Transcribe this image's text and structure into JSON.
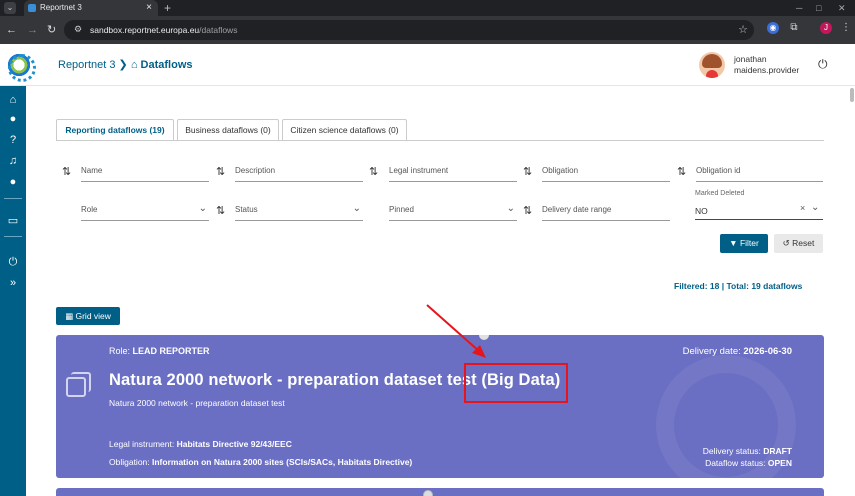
{
  "browser": {
    "tab_title": "Reportnet 3",
    "new_tab": "+",
    "url_host": "sandbox.reportnet.europa.eu",
    "url_path": "/dataflows",
    "profile_initial": "J"
  },
  "header": {
    "crumb_root": "Reportnet 3",
    "crumb_current": "Dataflows",
    "user_line1": "jonathan",
    "user_line2": "maidens.provider"
  },
  "tabs": [
    {
      "label": "Reporting dataflows (19)"
    },
    {
      "label": "Business dataflows (0)"
    },
    {
      "label": "Citizen science dataflows (0)"
    }
  ],
  "filters": {
    "name": "Name",
    "description": "Description",
    "legal_instrument": "Legal instrument",
    "obligation": "Obligation",
    "obligation_id": "Obligation id",
    "role": "Role",
    "status": "Status",
    "pinned": "Pinned",
    "delivery_date_range": "Delivery date range",
    "marked_deleted_label": "Marked Deleted",
    "marked_deleted_value": "NO"
  },
  "buttons": {
    "filter": "Filter",
    "reset": "Reset",
    "grid_view": "Grid view"
  },
  "summary": "Filtered: 18 | Total: 19 dataflows",
  "card": {
    "role_label": "Role: ",
    "role_value": "LEAD REPORTER",
    "delivery_date_label": "Delivery date: ",
    "delivery_date_value": "2026-06-30",
    "title": "Natura 2000 network - preparation dataset test (Big Data)",
    "subtitle": "Natura 2000 network - preparation dataset test",
    "legal_label": "Legal instrument: ",
    "legal_value": "Habitats Directive 92/43/EEC",
    "obligation_label": "Obligation: ",
    "obligation_value": "Information on Natura 2000 sites (SCIs/SACs, Habitats Directive)",
    "delivery_status_label": "Delivery status: ",
    "delivery_status_value": "DRAFT",
    "dataflow_status_label": "Dataflow status: ",
    "dataflow_status_value": "OPEN"
  },
  "colors": {
    "brand": "#005f87",
    "card": "#6b6fc3",
    "annotation": "#e8141c"
  }
}
